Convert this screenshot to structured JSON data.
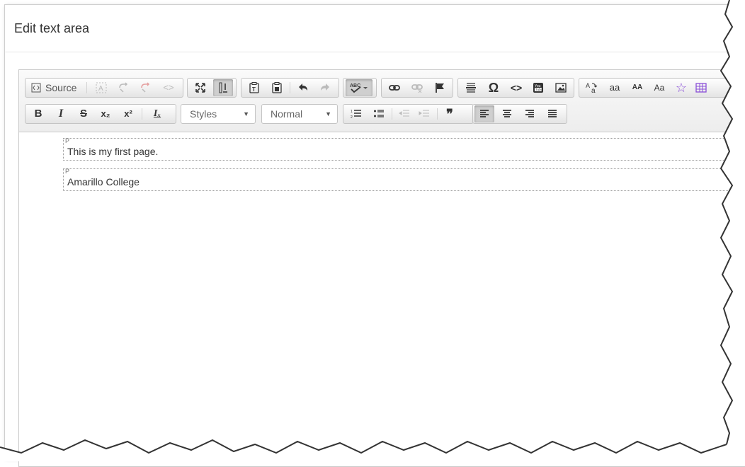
{
  "dialog": {
    "title": "Edit text area"
  },
  "toolbar": {
    "source_label": "Source",
    "styles_label": "Styles",
    "format_label": "Normal",
    "bold": "B",
    "italic": "I",
    "strike": "S",
    "subscript": "x₂",
    "superscript": "x²",
    "remove_format": "Iₓ",
    "text_transform_lower": "aa",
    "text_transform_upper": "AA",
    "text_transform_cap": "Aa"
  },
  "content": {
    "paragraphs": [
      {
        "tag": "P",
        "text": "This is my first page."
      },
      {
        "tag": "P",
        "text": "Amarillo College"
      }
    ]
  }
}
